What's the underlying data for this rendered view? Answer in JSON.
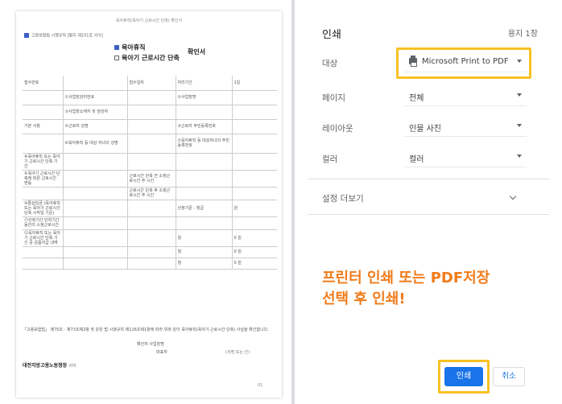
{
  "document": {
    "top_line": "육아휴직(육아기 근로시간 단축) 확인서",
    "form_note": "고용보험법 시행규칙 [별지 제101호 서식]",
    "title_option_1": "육아휴직",
    "title_option_2": "육아기 근로시간 단축",
    "title_suffix": "확인서",
    "header_row": [
      "접수번호",
      "",
      "접수일자",
      "",
      "처리기간",
      "1일"
    ],
    "rows": [
      [
        "",
        "①사업장관리번호",
        "",
        "②사업장명",
        ""
      ],
      [
        "",
        "③사업장소재지 및 담당자",
        "",
        "",
        ""
      ],
      [
        "기본 사항",
        "④근로자 성명",
        "",
        "⑤근로자 주민등록번호",
        ""
      ],
      [
        "",
        "⑥육아휴직 등 대상 자녀의 성명",
        "",
        "⑦육아휴직 등 대상자녀의 주민등록번호",
        ""
      ],
      [
        "⑧육아휴직 또는 육아기 근로시간 단축 기간",
        "",
        "",
        "",
        ""
      ],
      [
        "⑨육아기 근로시간 단축에 따른 근로시간 변동",
        "",
        "근로시간 단축 전 소정근로시간 주 시간",
        "",
        ""
      ],
      [
        "",
        "",
        "근로시간 단축 후 소정근로시간 주 시간",
        "",
        ""
      ],
      [
        "⑩통상임금 (육아휴직 또는 육아기 근로시간 단축 시작일 기준)",
        "",
        "",
        "산정기준 : 월급",
        "원"
      ],
      [
        "⑪산정기간 단위기간 동안의 소정근로시간",
        "",
        "",
        "",
        ""
      ],
      [
        "⑫육아휴직 또는 육아기 근로시간 단축 기간 중 금품지급 내역",
        "",
        "",
        "월",
        "0 원"
      ],
      [
        "",
        "",
        "",
        "월",
        "0 원"
      ],
      [
        "",
        "",
        "",
        "월",
        "0 원"
      ]
    ],
    "footer_text": "「고용보험법」 제70조 · 제73조제2항 및 같은 법 시행규칙 제116조제1항에 따라 위와 같이 육아휴직(육아기 근로시간 단축) 사실을 확인합니다.",
    "confirm_label": "확인자 사업장명",
    "representative_label": "대표자",
    "sign_note": "(서명 또는 인)",
    "agency": "대전지방고용노동청장",
    "agency_suffix": "귀하",
    "page_number": "01"
  },
  "panel": {
    "title": "인쇄",
    "sheet_count": "용지 1장",
    "settings": [
      {
        "label": "대상",
        "value": "Microsoft Print to PDF",
        "icon": "printer-icon"
      },
      {
        "label": "페이지",
        "value": "전체"
      },
      {
        "label": "레이아웃",
        "value": "인물 사진"
      },
      {
        "label": "컬러",
        "value": "컬러"
      }
    ],
    "more_settings": "설정 더보기",
    "annotation_line1": "프린터 인쇄 또는 PDF저장",
    "annotation_line2": "선택 후 인쇄!",
    "print_button": "인쇄",
    "cancel_button": "취소"
  },
  "colors": {
    "highlight": "#f8c124",
    "annotation": "#f07c1b",
    "primary": "#1a73e8"
  }
}
